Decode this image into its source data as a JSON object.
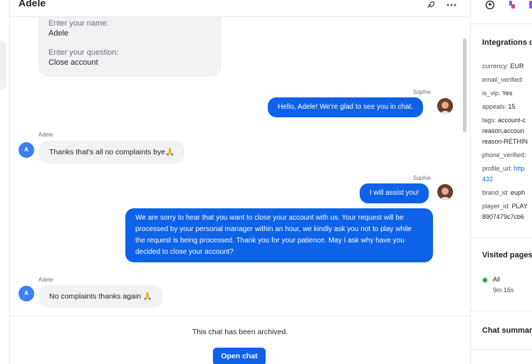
{
  "header": {
    "title": "Adele",
    "link_icon": "link-icon",
    "more_icon": "more-icon"
  },
  "form": {
    "name_label": "Enter your name:",
    "name_value": "Adele",
    "question_label": "Enter your question:",
    "question_value": "Close account"
  },
  "messages": [
    {
      "sender": "Sophie",
      "text": "Hello, Adele! We're glad to see you in chat."
    },
    {
      "sender": "Adele",
      "avatar": "A",
      "text": "Thanks that's all no complaints bye🙏"
    },
    {
      "sender": "Sophie",
      "text": "I will assist you!"
    },
    {
      "text": "We are sorry to hear that you want to close your account with us. Your request will be processed by your personal manager within an hour, we kindly ask you not to play while the request is being processed. Thank you for your patience. May I ask why have you decided to close your account?"
    },
    {
      "sender": "Adele",
      "avatar": "A",
      "text": "No complaints thanks again 🙏"
    }
  ],
  "footer": {
    "archived_text": "This chat has been archived.",
    "open_button": "Open chat"
  },
  "right_panel": {
    "tab_icons": [
      "user-circle-icon",
      "integration-icon",
      "document-icon"
    ],
    "integrations_title": "Integrations d",
    "attributes": [
      {
        "key": "currency:",
        "value": "EUR"
      },
      {
        "key": "email_verified:",
        "value": ""
      },
      {
        "key": "is_vip:",
        "value": "Yes"
      },
      {
        "key": "appeals:",
        "value": "15"
      },
      {
        "key": "tags:",
        "value": "account-c"
      },
      {
        "key": "",
        "value": "reason,accoun"
      },
      {
        "key": "",
        "value": "reason-RETHIN"
      },
      {
        "key": "phone_verified:",
        "value": ""
      },
      {
        "key": "profile_url:",
        "value": "http",
        "link": true
      },
      {
        "key": "",
        "value": "432",
        "link": true
      },
      {
        "key": "brand_id:",
        "value": "euph"
      },
      {
        "key": "player_id:",
        "value": "PLAY"
      },
      {
        "key": "",
        "value": "8907479c7cb6"
      }
    ],
    "visited_title": "Visited pages",
    "visited_item": "All",
    "visited_time": "9m 16s",
    "summary_title": "Chat summar"
  },
  "colors": {
    "accent": "#0d62e8",
    "online": "#2d9a4b"
  }
}
